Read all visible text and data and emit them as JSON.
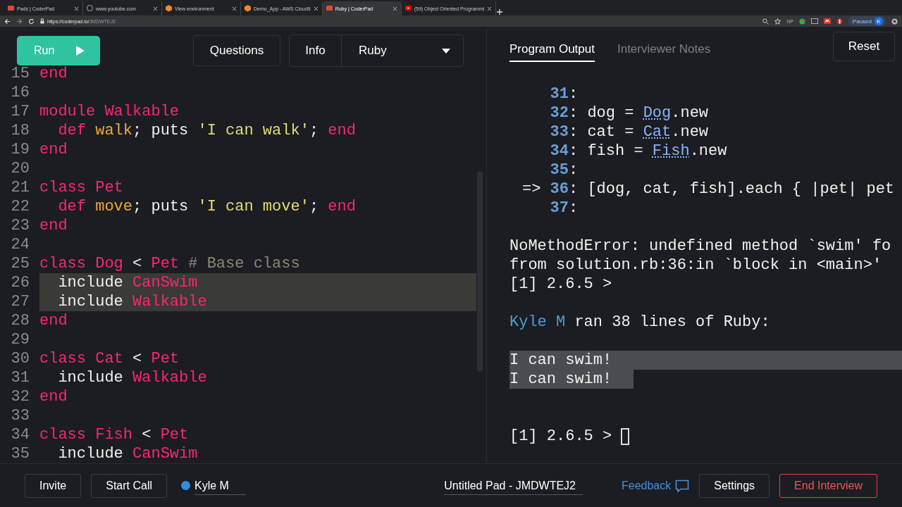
{
  "browser": {
    "tabs": [
      {
        "title": "Pads | CoderPad",
        "selected": false
      },
      {
        "title": "www.youtube.com",
        "selected": false
      },
      {
        "title": "View environment",
        "selected": false
      },
      {
        "title": "Demo_App - AWS Cloud9",
        "selected": false
      },
      {
        "title": "Ruby | CoderPad",
        "selected": true
      },
      {
        "title": "(59) Object Oriented Programmi",
        "selected": false
      }
    ],
    "url_host": "https://coderpad.io/",
    "url_path": "JMDWTEJ2",
    "extension_text": "NP",
    "profile_status": "Paused",
    "profile_initial": "K"
  },
  "toolbar": {
    "run": "Run",
    "questions": "Questions",
    "info": "Info",
    "language": "Ruby"
  },
  "code": {
    "lines": [
      {
        "number": "15",
        "highlighted": false,
        "tokens": [
          {
            "kind": "kw",
            "text": "end"
          }
        ]
      },
      {
        "number": "16",
        "highlighted": false
      },
      {
        "number": "17",
        "highlighted": false,
        "tokens": [
          {
            "kind": "kw",
            "text": "module "
          },
          {
            "kind": "const",
            "text": "Walkable"
          }
        ]
      },
      {
        "number": "18",
        "highlighted": false,
        "tokens": [
          {
            "kind": "kw",
            "text": "  def "
          },
          {
            "kind": "method",
            "text": "walk"
          },
          {
            "kind": "plain",
            "text": "; puts "
          },
          {
            "kind": "str",
            "text": "'I can walk'"
          },
          {
            "kind": "plain",
            "text": "; "
          },
          {
            "kind": "kw",
            "text": "end"
          }
        ]
      },
      {
        "number": "19",
        "highlighted": false,
        "tokens": [
          {
            "kind": "kw",
            "text": "end"
          }
        ]
      },
      {
        "number": "20",
        "highlighted": false
      },
      {
        "number": "21",
        "highlighted": false,
        "tokens": [
          {
            "kind": "kw",
            "text": "class "
          },
          {
            "kind": "const",
            "text": "Pet"
          }
        ]
      },
      {
        "number": "22",
        "highlighted": false,
        "tokens": [
          {
            "kind": "kw",
            "text": "  def "
          },
          {
            "kind": "method",
            "text": "move"
          },
          {
            "kind": "plain",
            "text": "; puts "
          },
          {
            "kind": "str",
            "text": "'I can move'"
          },
          {
            "kind": "plain",
            "text": "; "
          },
          {
            "kind": "kw",
            "text": "end"
          }
        ]
      },
      {
        "number": "23",
        "highlighted": false,
        "tokens": [
          {
            "kind": "kw",
            "text": "end"
          }
        ]
      },
      {
        "number": "24",
        "highlighted": false
      },
      {
        "number": "25",
        "highlighted": false,
        "tokens": [
          {
            "kind": "kw",
            "text": "class "
          },
          {
            "kind": "const",
            "text": "Dog"
          },
          {
            "kind": "plain",
            "text": " < "
          },
          {
            "kind": "const",
            "text": "Pet"
          },
          {
            "kind": "comment",
            "text": " # Base class"
          }
        ]
      },
      {
        "number": "26",
        "highlighted": true,
        "tokens": [
          {
            "kind": "plain",
            "text": "  include "
          },
          {
            "kind": "const",
            "text": "CanSwim"
          }
        ]
      },
      {
        "number": "27",
        "highlighted": true,
        "tokens": [
          {
            "kind": "plain",
            "text": "  include "
          },
          {
            "kind": "const",
            "text": "Walkable"
          }
        ]
      },
      {
        "number": "28",
        "highlighted": false,
        "tokens": [
          {
            "kind": "kw",
            "text": "end"
          }
        ]
      },
      {
        "number": "29",
        "highlighted": false
      },
      {
        "number": "30",
        "highlighted": false,
        "tokens": [
          {
            "kind": "kw",
            "text": "class "
          },
          {
            "kind": "const",
            "text": "Cat"
          },
          {
            "kind": "plain",
            "text": " < "
          },
          {
            "kind": "const",
            "text": "Pet"
          }
        ]
      },
      {
        "number": "31",
        "highlighted": false,
        "tokens": [
          {
            "kind": "plain",
            "text": "  include "
          },
          {
            "kind": "const",
            "text": "Walkable"
          }
        ]
      },
      {
        "number": "32",
        "highlighted": false,
        "tokens": [
          {
            "kind": "kw",
            "text": "end"
          }
        ]
      },
      {
        "number": "33",
        "highlighted": false
      },
      {
        "number": "34",
        "highlighted": false,
        "tokens": [
          {
            "kind": "kw",
            "text": "class "
          },
          {
            "kind": "const",
            "text": "Fish"
          },
          {
            "kind": "plain",
            "text": " < "
          },
          {
            "kind": "const",
            "text": "Pet"
          }
        ]
      },
      {
        "number": "35",
        "highlighted": false,
        "tokens": [
          {
            "kind": "plain",
            "text": "  include "
          },
          {
            "kind": "const",
            "text": "CanSwim"
          }
        ]
      }
    ]
  },
  "output": {
    "tabs": [
      {
        "label": "Program Output",
        "selected": true
      },
      {
        "label": "Interviewer Notes",
        "selected": false
      }
    ],
    "reset": "Reset",
    "lines": [
      {
        "kind": "blank"
      },
      {
        "kind": "source",
        "number": "31",
        "tokens": [
          {
            "kind": "plain",
            "text": ":"
          }
        ]
      },
      {
        "kind": "source",
        "number": "32",
        "tokens": [
          {
            "kind": "plain",
            "text": ": dog = "
          },
          {
            "kind": "const",
            "text": "Dog"
          },
          {
            "kind": "plain",
            "text": ".new"
          }
        ]
      },
      {
        "kind": "source",
        "number": "33",
        "tokens": [
          {
            "kind": "plain",
            "text": ": cat = "
          },
          {
            "kind": "const",
            "text": "Cat"
          },
          {
            "kind": "plain",
            "text": ".new"
          }
        ]
      },
      {
        "kind": "source",
        "number": "34",
        "tokens": [
          {
            "kind": "plain",
            "text": ": fish = "
          },
          {
            "kind": "const",
            "text": "Fish"
          },
          {
            "kind": "plain",
            "text": ".new"
          }
        ]
      },
      {
        "kind": "source",
        "number": "35",
        "tokens": [
          {
            "kind": "plain",
            "text": ":"
          }
        ]
      },
      {
        "kind": "source",
        "arrow": "=>",
        "number": "36",
        "tokens": [
          {
            "kind": "plain",
            "text": ": [dog, cat, fish].each { |pet| pet"
          }
        ]
      },
      {
        "kind": "source",
        "number": "37",
        "tokens": [
          {
            "kind": "plain",
            "text": ":"
          }
        ]
      },
      {
        "kind": "blank"
      },
      {
        "kind": "text",
        "text": "NoMethodError: undefined method `swim' fo"
      },
      {
        "kind": "text",
        "text": "from solution.rb:36:in `block in <main>'"
      },
      {
        "kind": "text",
        "text": "[1] 2.6.5 >"
      },
      {
        "kind": "blank"
      },
      {
        "kind": "run",
        "user": "Kyle M",
        "text": " ran 38 lines of Ruby:"
      },
      {
        "kind": "blank"
      },
      {
        "kind": "result",
        "text": "I can swim!"
      },
      {
        "kind": "result",
        "text": "I can swim!"
      },
      {
        "kind": "blank"
      },
      {
        "kind": "blank"
      },
      {
        "kind": "prompt",
        "text": "[1] 2.6.5 > "
      }
    ]
  },
  "footer": {
    "invite": "Invite",
    "start_call": "Start Call",
    "user": {
      "name": "Kyle M",
      "color": "#2f8fe0"
    },
    "pad_title": "Untitled Pad - JMDWTEJ2",
    "feedback": "Feedback",
    "settings": "Settings",
    "end": "End Interview"
  }
}
